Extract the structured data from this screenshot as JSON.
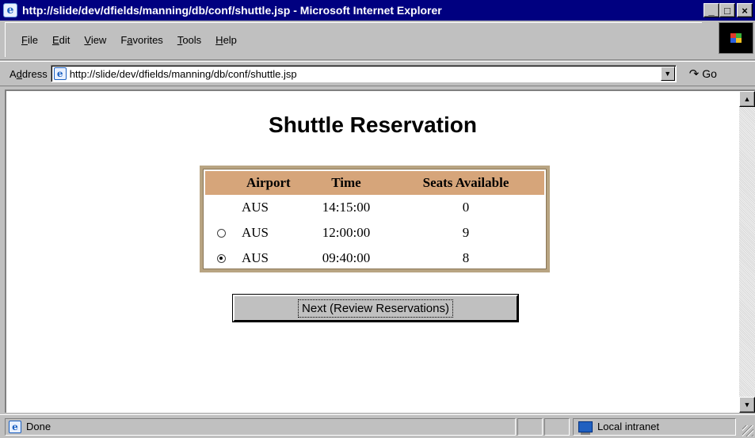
{
  "window": {
    "title": "http://slide/dev/dfields/manning/db/conf/shuttle.jsp - Microsoft Internet Explorer",
    "controls": {
      "minimize": "_",
      "maximize": "□",
      "close": "×"
    }
  },
  "menu": {
    "items": [
      {
        "label": "File",
        "accel": "F",
        "rest": "ile"
      },
      {
        "label": "Edit",
        "accel": "E",
        "rest": "dit"
      },
      {
        "label": "View",
        "accel": "V",
        "rest": "iew"
      },
      {
        "label": "Favorites",
        "pre": "F",
        "accel": "a",
        "rest": "vorites"
      },
      {
        "label": "Tools",
        "accel": "T",
        "rest": "ools"
      },
      {
        "label": "Help",
        "accel": "H",
        "rest": "elp"
      }
    ]
  },
  "address": {
    "label_pre": "A",
    "label_accel": "d",
    "label_rest": "dress",
    "value": "http://slide/dev/dfields/manning/db/conf/shuttle.jsp",
    "go_label": "Go"
  },
  "page": {
    "title": "Shuttle Reservation",
    "table": {
      "headers": [
        "Airport",
        "Time",
        "Seats Available"
      ],
      "rows": [
        {
          "radio": "none",
          "airport": "AUS",
          "time": "14:15:00",
          "seats": "0"
        },
        {
          "radio": "unchecked",
          "airport": "AUS",
          "time": "12:00:00",
          "seats": "9"
        },
        {
          "radio": "checked",
          "airport": "AUS",
          "time": "09:40:00",
          "seats": "8"
        }
      ]
    },
    "next_button": "Next (Review Reservations)"
  },
  "status": {
    "text": "Done",
    "zone": "Local intranet"
  },
  "colors": {
    "titlebar": "#000080",
    "table_header": "#d6a57a",
    "table_border": "#b8a482",
    "chrome": "#c0c0c0"
  }
}
